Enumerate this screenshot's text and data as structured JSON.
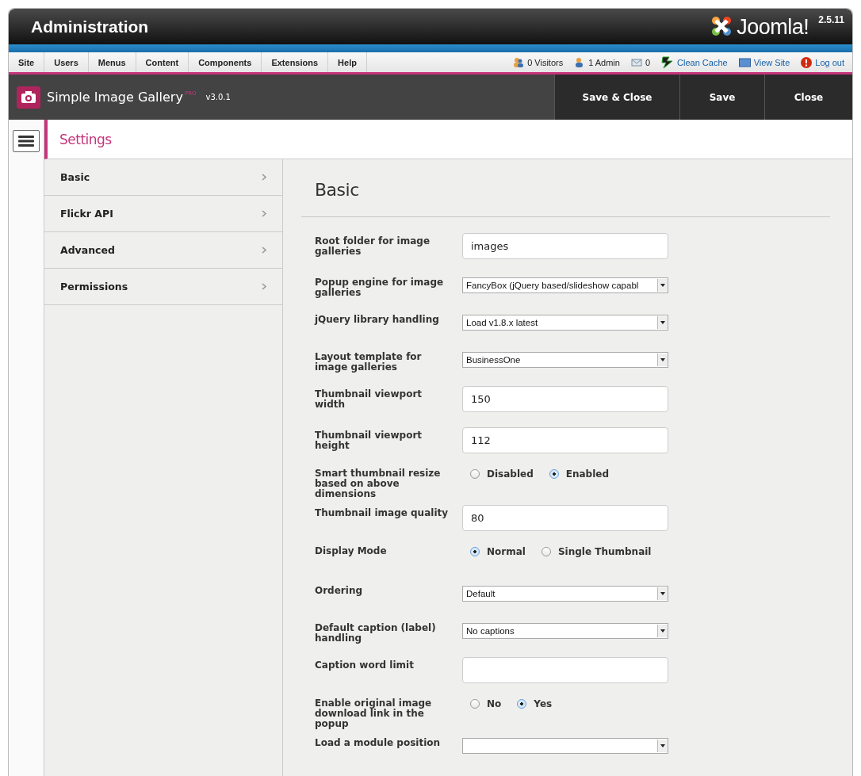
{
  "header": {
    "title": "Administration",
    "logo_text": "Joomla!",
    "version": "2.5.11"
  },
  "menu": [
    {
      "label": "Site"
    },
    {
      "label": "Users"
    },
    {
      "label": "Menus"
    },
    {
      "label": "Content"
    },
    {
      "label": "Components"
    },
    {
      "label": "Extensions"
    },
    {
      "label": "Help"
    }
  ],
  "status": [
    {
      "kind": "visitors",
      "label": "0 Visitors"
    },
    {
      "kind": "admins",
      "label": "1 Admin"
    },
    {
      "kind": "messages",
      "label": "0"
    },
    {
      "kind": "cache",
      "label": "Clean Cache"
    },
    {
      "kind": "site",
      "label": "View Site"
    },
    {
      "kind": "logout",
      "label": "Log out"
    }
  ],
  "toolbar": {
    "title": "Simple Image Gallery",
    "edition": "PRO",
    "version": "v3.0.1",
    "buttons": [
      "Save & Close",
      "Save",
      "Close"
    ]
  },
  "settings": {
    "title": "Settings",
    "tabs": [
      {
        "label": "Basic"
      },
      {
        "label": "Flickr API"
      },
      {
        "label": "Advanced"
      },
      {
        "label": "Permissions"
      }
    ]
  },
  "panel": {
    "heading": "Basic",
    "fields": [
      {
        "kind": "text",
        "label": "Root folder for image galleries",
        "value": "images"
      },
      {
        "kind": "select",
        "label": "Popup engine for image galleries",
        "value": "FancyBox (jQuery based/slideshow capabl"
      },
      {
        "kind": "select",
        "label": "jQuery library handling",
        "value": "Load v1.8.x latest"
      },
      {
        "kind": "select",
        "label": "Layout template for image galleries",
        "value": "BusinessOne"
      },
      {
        "kind": "text",
        "label": "Thumbnail viewport width",
        "value": "150"
      },
      {
        "kind": "text",
        "label": "Thumbnail viewport height",
        "value": "112"
      },
      {
        "kind": "radio",
        "label": "Smart thumbnail resize based on above dimensions",
        "options": [
          {
            "label": "Disabled",
            "selected": false
          },
          {
            "label": "Enabled",
            "selected": true
          }
        ]
      },
      {
        "kind": "text",
        "label": "Thumbnail image quality",
        "value": "80"
      },
      {
        "kind": "radio",
        "label": "Display Mode",
        "options": [
          {
            "label": "Normal",
            "selected": true
          },
          {
            "label": "Single Thumbnail",
            "selected": false
          }
        ]
      },
      {
        "kind": "select",
        "label": "Ordering",
        "value": "Default"
      },
      {
        "kind": "select",
        "label": "Default caption (label) handling",
        "value": "No captions"
      },
      {
        "kind": "text",
        "label": "Caption word limit"
      },
      {
        "kind": "radio",
        "label": "Enable original image download link in the popup",
        "options": [
          {
            "label": "No",
            "selected": false
          },
          {
            "label": "Yes",
            "selected": true
          }
        ]
      },
      {
        "kind": "select",
        "label": "Load a module position"
      }
    ]
  }
}
